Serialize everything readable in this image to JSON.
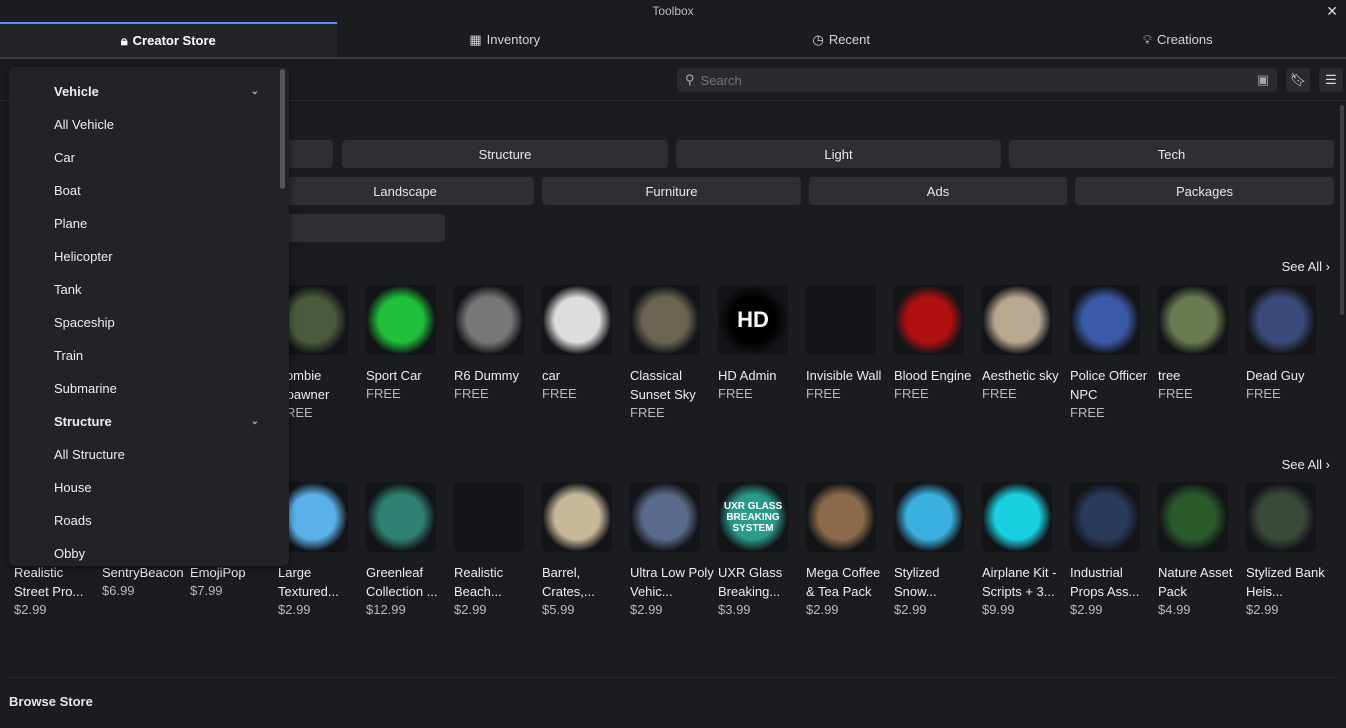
{
  "window": {
    "title": "Toolbox",
    "close": "✕"
  },
  "tabs": [
    {
      "label": "Creator Store",
      "icon": "bag-icon"
    },
    {
      "label": "Inventory",
      "icon": "grid-icon"
    },
    {
      "label": "Recent",
      "icon": "clock-icon"
    },
    {
      "label": "Creations",
      "icon": "bulb-icon"
    }
  ],
  "search": {
    "placeholder": "Search"
  },
  "categories_row1": [
    "Structure",
    "Light",
    "Tech"
  ],
  "categories_row2": [
    "Landscape",
    "Furniture",
    "Ads",
    "Packages"
  ],
  "see_all": "See All",
  "row1": [
    {
      "name": "Zombie Spawner",
      "price": "FREE",
      "color": "#4a5a3a"
    },
    {
      "name": "Sport Car",
      "price": "FREE",
      "color": "#1fbf3a"
    },
    {
      "name": "R6 Dummy",
      "price": "FREE",
      "color": "#777"
    },
    {
      "name": "car",
      "price": "FREE",
      "color": "#ddd"
    },
    {
      "name": "Classical Sunset Sky",
      "price": "FREE",
      "color": "#6a6450"
    },
    {
      "name": "HD Admin",
      "price": "FREE",
      "color": "#000",
      "thumb_text": "HD"
    },
    {
      "name": "Invisible Wall",
      "price": "FREE",
      "color": "#131418"
    },
    {
      "name": "Blood Engine",
      "price": "FREE",
      "color": "#b01010"
    },
    {
      "name": "Aesthetic sky",
      "price": "FREE",
      "color": "#b8a890"
    },
    {
      "name": "Police Officer NPC",
      "price": "FREE",
      "color": "#3a5aa8"
    },
    {
      "name": "tree",
      "price": "FREE",
      "color": "#6a7a50"
    },
    {
      "name": "Dead Guy",
      "price": "FREE",
      "color": "#3a4a7a"
    }
  ],
  "row2": [
    {
      "name": "Realistic Street Pro...",
      "price": "$2.99",
      "color": "#555"
    },
    {
      "name": "SentryBeacon",
      "price": "$6.99",
      "color": "#444"
    },
    {
      "name": "EmojiPop",
      "price": "$7.99",
      "color": "#666"
    },
    {
      "name": "Large Textured...",
      "price": "$2.99",
      "color": "#5ab0e8"
    },
    {
      "name": "Greenleaf Collection ...",
      "price": "$12.99",
      "color": "#2e8070"
    },
    {
      "name": "Realistic Beach...",
      "price": "$2.99",
      "color": "#131418"
    },
    {
      "name": "Barrel, Crates,...",
      "price": "$5.99",
      "color": "#c8b89a"
    },
    {
      "name": "Ultra Low Poly Vehic...",
      "price": "$2.99",
      "color": "#5a6a8a"
    },
    {
      "name": "UXR Glass Breaking...",
      "price": "$3.99",
      "color": "#2a9a8a",
      "thumb_text": "UXR GLASS BREAKING SYSTEM"
    },
    {
      "name": "Mega Coffee & Tea Pack",
      "price": "$2.99",
      "color": "#8a6a4a"
    },
    {
      "name": "Stylized Snow...",
      "price": "$2.99",
      "color": "#3ab0e0"
    },
    {
      "name": "Airplane Kit - Scripts + 3...",
      "price": "$9.99",
      "color": "#1ad0e0"
    },
    {
      "name": "Industrial Props Ass...",
      "price": "$2.99",
      "color": "#2a3a5a"
    },
    {
      "name": "Nature Asset Pack",
      "price": "$4.99",
      "color": "#2a5a2a"
    },
    {
      "name": "Stylized Bank Heis...",
      "price": "$2.99",
      "color": "#3a4a3a"
    }
  ],
  "browse_store": "Browse Store",
  "dropdown": {
    "sections": [
      {
        "title": "Vehicle",
        "items": [
          "All Vehicle",
          "Car",
          "Boat",
          "Plane",
          "Helicopter",
          "Tank",
          "Spaceship",
          "Train",
          "Submarine"
        ]
      },
      {
        "title": "Structure",
        "items": [
          "All Structure",
          "House",
          "Roads",
          "Obby"
        ]
      }
    ]
  }
}
